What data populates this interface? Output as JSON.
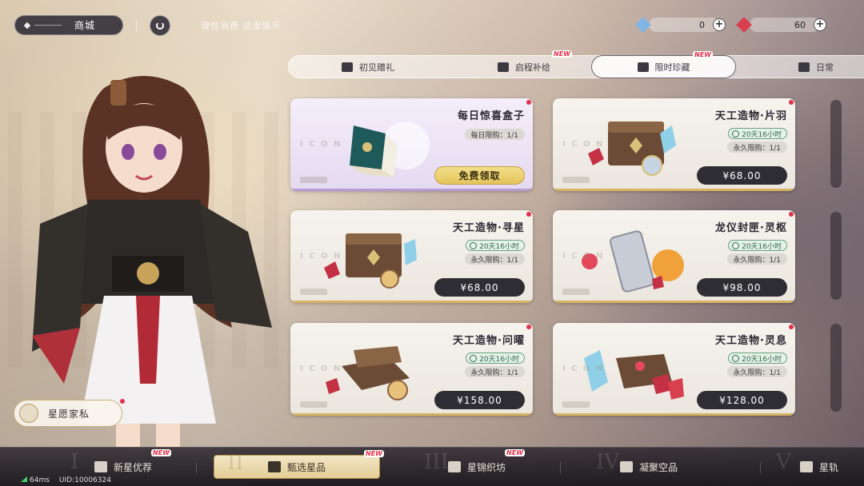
{
  "header": {
    "shop_label": "商城",
    "notice": "理性消费 适度娱乐"
  },
  "currencies": [
    {
      "name": "star-crystal-icon",
      "value": "0",
      "color": "#7fb6e6"
    },
    {
      "name": "red-gem-icon",
      "value": "60",
      "color": "#d8404f"
    }
  ],
  "tabs": [
    {
      "label": "初见赠礼",
      "new": ""
    },
    {
      "label": "启程补给",
      "new": "NEW"
    },
    {
      "label": "限时珍藏",
      "new": "NEW",
      "active": true
    },
    {
      "label": "日常",
      "new": ""
    }
  ],
  "cards": [
    {
      "title": "每日惊喜盒子",
      "timer": "",
      "limit": "每日限购：1/1",
      "price": "免费领取"
    },
    {
      "title": "天工造物·片羽",
      "timer": "20天16小时",
      "limit": "永久限购：1/1",
      "price": "¥68.00"
    },
    {
      "title": "天工造物·寻星",
      "timer": "20天16小时",
      "limit": "永久限购：1/1",
      "price": "¥68.00"
    },
    {
      "title": "龙仪封匣·灵枢",
      "timer": "20天16小时",
      "limit": "永久限购：1/1",
      "price": "¥98.00"
    },
    {
      "title": "天工造物·问曜",
      "timer": "20天16小时",
      "limit": "永久限购：1/1",
      "price": "¥158.00"
    },
    {
      "title": "天工造物·灵息",
      "timer": "20天16小时",
      "limit": "永久限购：1/1",
      "price": "¥128.00"
    }
  ],
  "home_badge": {
    "label": "星愿家私"
  },
  "bottom_nav": [
    {
      "roman": "I",
      "label": "新星优荐",
      "new": "NEW"
    },
    {
      "roman": "II",
      "label": "甄选星品",
      "new": "NEW",
      "active": true
    },
    {
      "roman": "III",
      "label": "星锦织坊",
      "new": "NEW"
    },
    {
      "roman": "IV",
      "label": "凝聚空品",
      "new": ""
    },
    {
      "roman": "V",
      "label": "星轨",
      "new": ""
    }
  ],
  "status": {
    "ping": "64ms",
    "uid": "UID:10006324"
  },
  "colors": {
    "accent_gold": "#e4c45a",
    "new_red": "#e2314b",
    "timer_green": "#6aa27c",
    "dark_button": "#2f2d34"
  }
}
